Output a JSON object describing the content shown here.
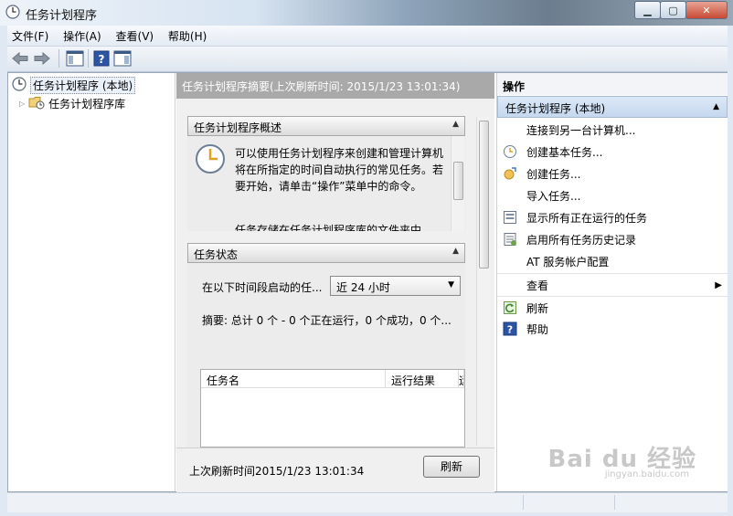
{
  "window": {
    "title": "任务计划程序",
    "controls": [
      "minimize",
      "maximize",
      "close"
    ]
  },
  "menubar": {
    "items": [
      "文件(F)",
      "操作(A)",
      "查看(V)",
      "帮助(H)"
    ]
  },
  "toolbar": {
    "buttons": [
      "back-icon",
      "forward-icon",
      "show-hide-tree-icon",
      "help-icon",
      "show-hide-action-pane-icon"
    ]
  },
  "tree": {
    "items": [
      {
        "label": "任务计划程序 (本地)",
        "selected": true
      },
      {
        "label": "任务计划程序库"
      }
    ]
  },
  "center": {
    "header": "任务计划程序摘要(上次刷新时间: 2015/1/23 13:01:34)",
    "overview": {
      "title": "任务计划程序概述",
      "text": "可以使用任务计划程序来创建和管理计算机将在所指定的时间自动执行的常见任务。若要开始，请单击“操作”菜单中的命令。",
      "text2": "任务存储在任务计划程序库的文件夹中"
    },
    "status": {
      "title": "任务状态",
      "range_label": "在以下时间段启动的任...",
      "range_value": "近 24 小时",
      "summary": "摘要: 总计 0 个 - 0 个正在运行，0 个成功，0 个...",
      "columns": [
        "任务名",
        "运行结果",
        "运"
      ]
    },
    "footer": {
      "last_refresh": "上次刷新时间2015/1/23 13:01:34",
      "refresh_button": "刷新"
    }
  },
  "actions": {
    "title": "操作",
    "group": "任务计划程序 (本地)",
    "items": [
      {
        "label": "连接到另一台计算机...",
        "icon": ""
      },
      {
        "label": "创建基本任务...",
        "icon": "wizard-clock-icon"
      },
      {
        "label": "创建任务...",
        "icon": "create-task-icon"
      },
      {
        "label": "导入任务...",
        "icon": ""
      },
      {
        "label": "显示所有正在运行的任务",
        "icon": "running-tasks-icon"
      },
      {
        "label": "启用所有任务历史记录",
        "icon": "history-icon"
      },
      {
        "label": "AT 服务帐户配置",
        "icon": ""
      },
      {
        "label": "查看",
        "icon": "",
        "submenu": true
      },
      {
        "label": "刷新",
        "icon": "refresh-icon"
      },
      {
        "label": "帮助",
        "icon": "help-icon"
      }
    ]
  },
  "watermark": {
    "text": "Bai du 经验",
    "url": "jingyan.baidu.com"
  }
}
